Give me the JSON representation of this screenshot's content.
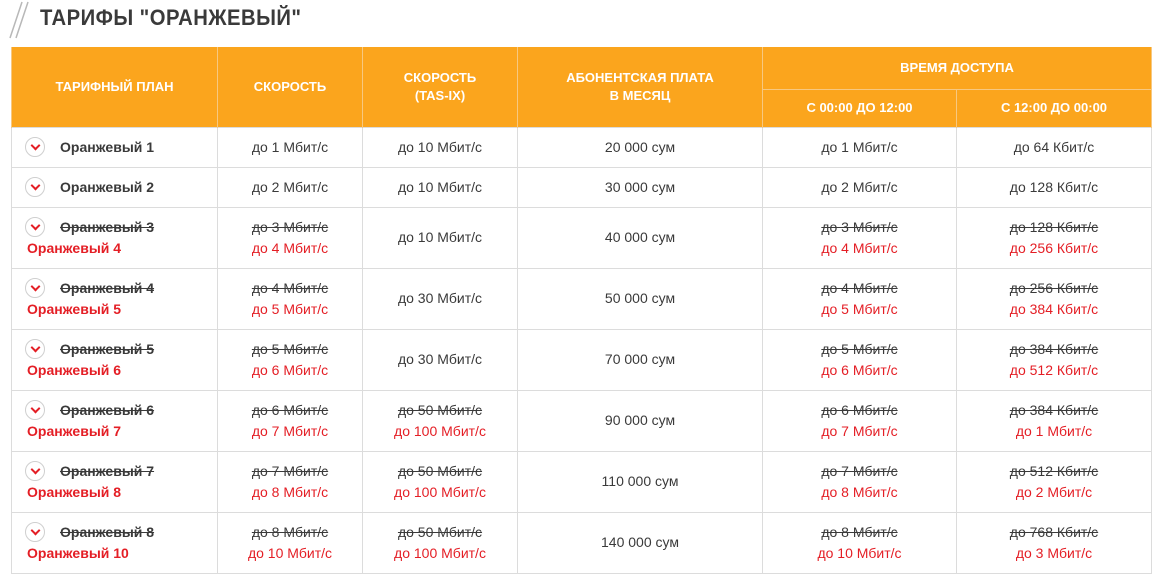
{
  "title": "ТАРИФЫ \"ОРАНЖЕВЫЙ\"",
  "headers": {
    "plan": "ТАРИФНЫЙ ПЛАН",
    "speed": "СКОРОСТЬ",
    "tasix_line1": "СКОРОСТЬ",
    "tasix_line2": "(TAS-IX)",
    "fee_line1": "АБОНЕНТСКАЯ ПЛАТА",
    "fee_line2": "В МЕСЯЦ",
    "access": "ВРЕМЯ ДОСТУПА",
    "access_day": "С 00:00 ДО 12:00",
    "access_night": "С 12:00 ДО 00:00"
  },
  "rows": [
    {
      "plan": "Оранжевый 1",
      "speed": "до 1 Мбит/с",
      "tasix": "до 10 Мбит/с",
      "fee": "20 000 сум",
      "day": "до 1 Мбит/с",
      "night": "до 64 Кбит/с"
    },
    {
      "plan": "Оранжевый 2",
      "speed": "до 2 Мбит/с",
      "tasix": "до 10 Мбит/с",
      "fee": "30 000 сум",
      "day": "до 2 Мбит/с",
      "night": "до 128 Кбит/с"
    },
    {
      "plan_old": "Оранжевый 3",
      "plan_new": "Оранжевый 4",
      "speed_old": "до 3 Мбит/с",
      "speed_new": "до 4 Мбит/с",
      "tasix": "до 10 Мбит/с",
      "fee": "40 000 сум",
      "day_old": "до 3 Мбит/с",
      "day_new": "до 4 Мбит/с",
      "night_old": "до 128 Кбит/с",
      "night_new": "до 256 Кбит/с"
    },
    {
      "plan_old": "Оранжевый 4",
      "plan_new": "Оранжевый 5",
      "speed_old": "до 4 Мбит/с",
      "speed_new": "до 5 Мбит/с",
      "tasix": "до 30 Мбит/с",
      "fee": "50 000 сум",
      "day_old": "до 4 Мбит/с",
      "day_new": "до 5 Мбит/с",
      "night_old": "до 256 Кбит/с",
      "night_new": "до 384 Кбит/с"
    },
    {
      "plan_old": "Оранжевый 5",
      "plan_new": "Оранжевый 6",
      "speed_old": "до 5 Мбит/с",
      "speed_new": "до 6 Мбит/с",
      "tasix": "до 30 Мбит/с",
      "fee": "70 000 сум",
      "day_old": "до 5 Мбит/с",
      "day_new": "до 6 Мбит/с",
      "night_old": "до 384 Кбит/с",
      "night_new": "до 512 Кбит/с"
    },
    {
      "plan_old": "Оранжевый 6",
      "plan_new": "Оранжевый 7",
      "speed_old": "до 6 Мбит/с",
      "speed_new": "до 7 Мбит/с",
      "tasix_old": "до 50 Мбит/с",
      "tasix_new": "до 100 Мбит/с",
      "fee": "90 000 сум",
      "day_old": "до 6 Мбит/с",
      "day_new": "до 7 Мбит/с",
      "night_old": "до 384 Кбит/с",
      "night_new": "до 1 Мбит/с"
    },
    {
      "plan_old": "Оранжевый 7",
      "plan_new": "Оранжевый 8",
      "speed_old": "до 7 Мбит/с",
      "speed_new": "до 8 Мбит/с",
      "tasix_old": "до 50 Мбит/с",
      "tasix_new": "до 100 Мбит/с",
      "fee": "110 000 сум",
      "day_old": "до 7 Мбит/с",
      "day_new": "до 8 Мбит/с",
      "night_old": "до 512 Кбит/с",
      "night_new": "до 2 Мбит/с"
    },
    {
      "plan_old": "Оранжевый 8",
      "plan_new": "Оранжевый 10",
      "speed_old": "до 8 Мбит/с",
      "speed_new": "до 10 Мбит/с",
      "tasix_old": "до 50 Мбит/с",
      "tasix_new": "до 100 Мбит/с",
      "fee": "140 000 сум",
      "day_old": "до 8 Мбит/с",
      "day_new": "до 10 Мбит/с",
      "night_old": "до 768 Кбит/с",
      "night_new": "до 3 Мбит/с"
    }
  ],
  "colors": {
    "header_bg": "#fba51d",
    "accent_red": "#e41e25",
    "text": "#3a3a3a",
    "border": "#dcdcdc"
  },
  "icons": {
    "expand": "chevron-down-icon"
  }
}
